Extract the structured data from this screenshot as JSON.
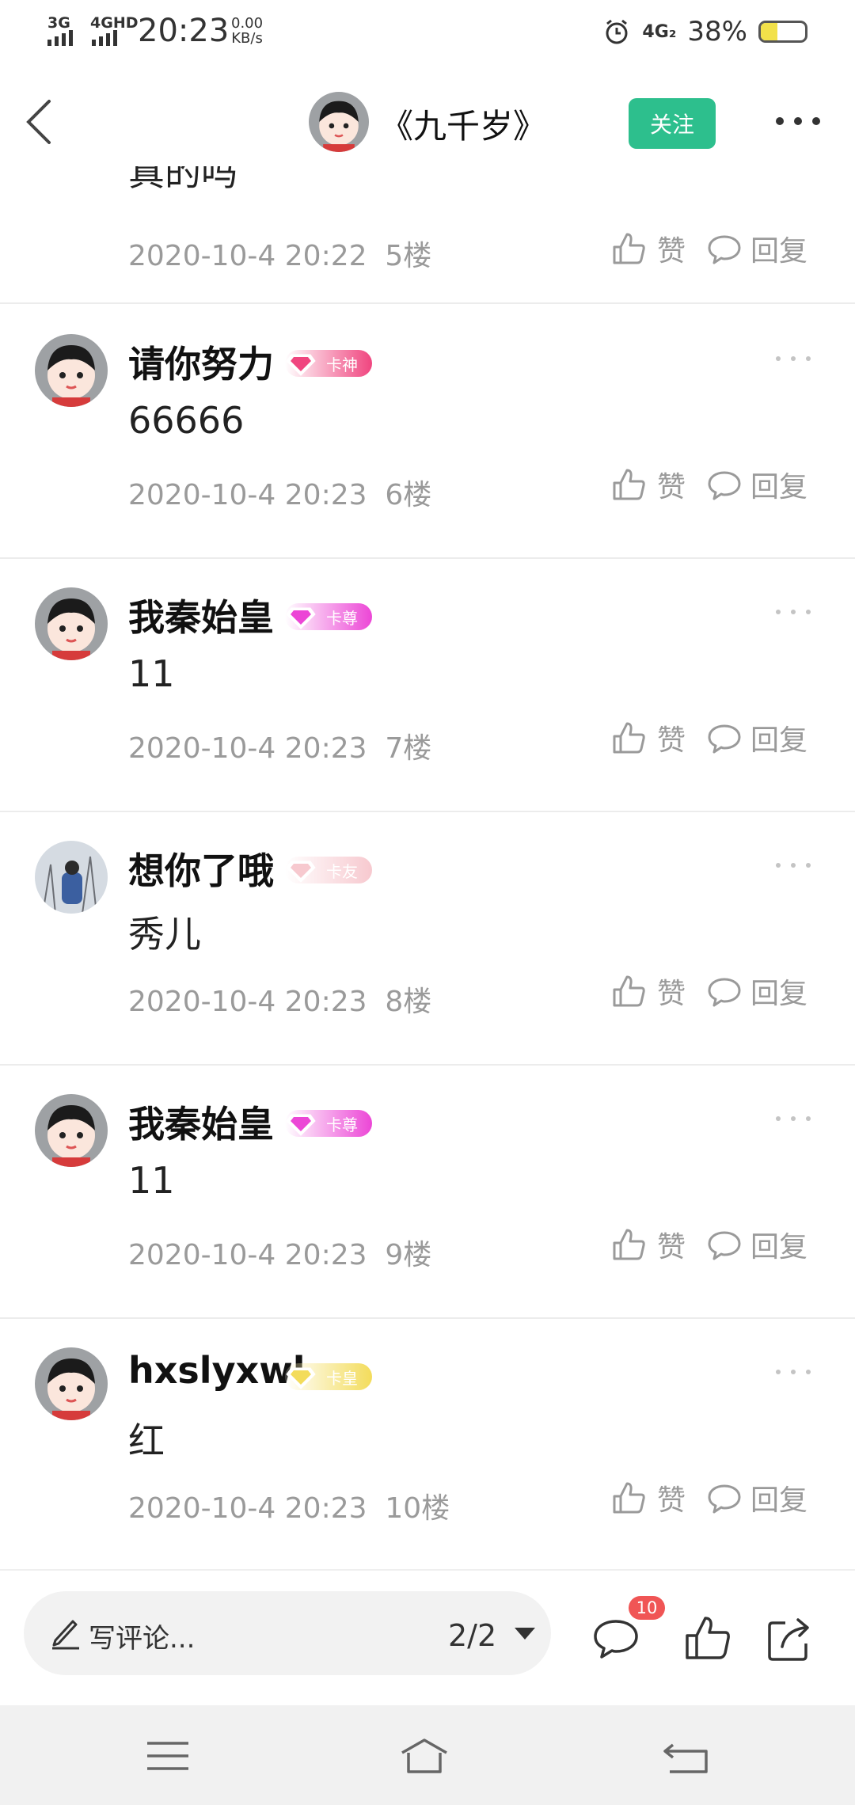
{
  "status_bar": {
    "net1": "3G",
    "net2": "4GHD",
    "time": "20:23",
    "speed_value": "0.00",
    "speed_unit": "KB/s",
    "lte": "4G₂",
    "battery": "38%",
    "battery_level": 0.38
  },
  "header": {
    "title": "《九千岁》",
    "follow_label": "关注"
  },
  "partial_comment": {
    "content": "真的吗",
    "timestamp": "2020-10-4 20:22",
    "floor": "5楼"
  },
  "labels": {
    "like": "赞",
    "reply": "回复"
  },
  "comments": [
    {
      "username": "请你努力",
      "badge": "卡神",
      "badge_color": "#f0457f",
      "content": "66666",
      "timestamp": "2020-10-4 20:23",
      "floor": "6楼"
    },
    {
      "username": "我秦始皇",
      "badge": "卡尊",
      "badge_color": "#ec46d6",
      "content": "11",
      "timestamp": "2020-10-4 20:23",
      "floor": "7楼"
    },
    {
      "username": "想你了哦",
      "badge": "卡友",
      "badge_color": "#f7c9cf",
      "content": "秀儿",
      "timestamp": "2020-10-4 20:23",
      "floor": "8楼"
    },
    {
      "username": "我秦始皇",
      "badge": "卡尊",
      "badge_color": "#ec46d6",
      "content": "11",
      "timestamp": "2020-10-4 20:23",
      "floor": "9楼"
    },
    {
      "username": "hxslyxwl",
      "badge": "卡皇",
      "badge_color": "#f3dc5b",
      "content": "红",
      "timestamp": "2020-10-4 20:23",
      "floor": "10楼"
    }
  ],
  "bottom_bar": {
    "placeholder": "写评论...",
    "page_indicator": "2/2",
    "comment_count": "10"
  },
  "colors": {
    "accent": "#2dbf8d",
    "badge_red": "#f05555"
  }
}
